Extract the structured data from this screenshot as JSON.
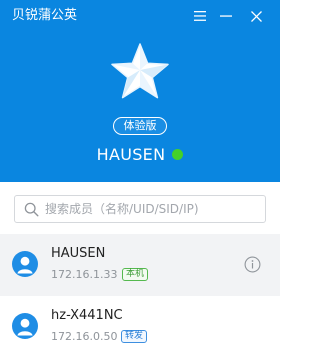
{
  "app": {
    "title": "贝锐蒲公英",
    "edition_badge": "体验版",
    "brand_color": "#0a86e0"
  },
  "window_controls": [
    {
      "name": "menu-icon"
    },
    {
      "name": "minimize-icon"
    },
    {
      "name": "close-icon"
    }
  ],
  "user": {
    "name": "HAUSEN",
    "status": "online",
    "status_color": "#44d12a"
  },
  "search": {
    "placeholder": "搜索成员（名称/UID/SID/IP)",
    "value": ""
  },
  "members": [
    {
      "name": "HAUSEN",
      "ip": "172.16.1.33",
      "tag": "本机",
      "tag_color": "#55b94f",
      "selected": true,
      "icon": "info-icon"
    },
    {
      "name": "hz-X441NC",
      "ip": "172.16.0.50",
      "tag": "转发",
      "tag_color": "#3d8fe0",
      "selected": false
    }
  ]
}
